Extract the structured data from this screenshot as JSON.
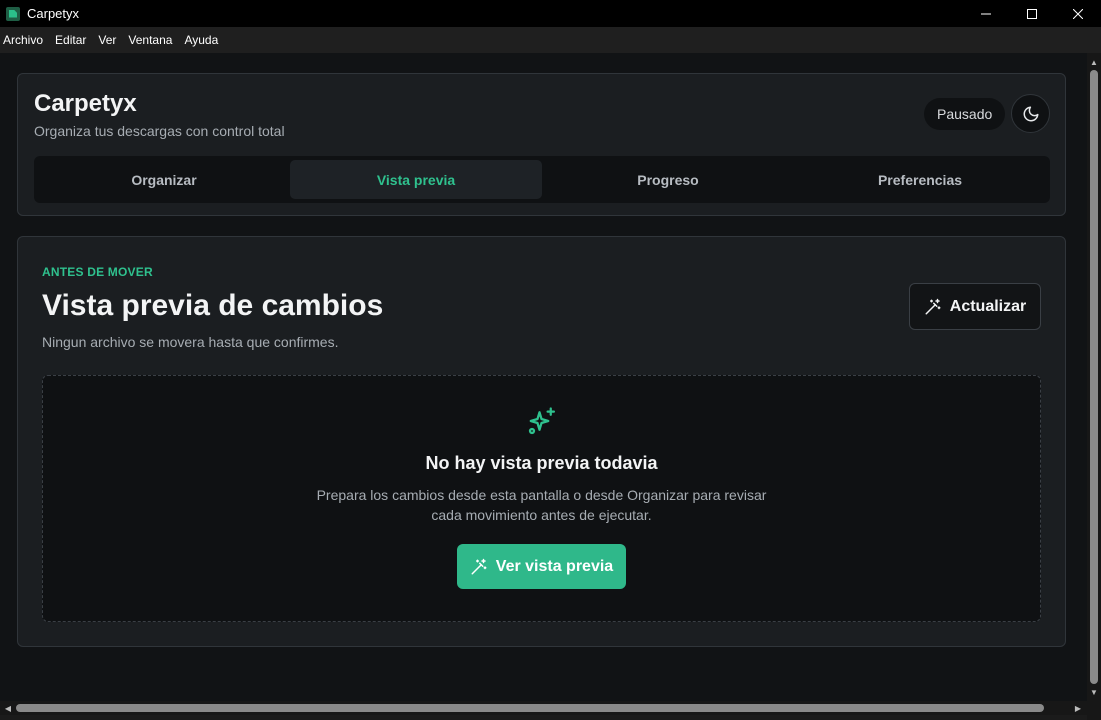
{
  "window": {
    "title": "Carpetyx",
    "controls": {
      "minimize": "─",
      "maximize": "☐",
      "close": "✕"
    }
  },
  "menu": [
    "Archivo",
    "Editar",
    "Ver",
    "Ventana",
    "Ayuda"
  ],
  "header": {
    "app_name": "Carpetyx",
    "tagline": "Organiza tus descargas con control total",
    "status": "Pausado",
    "theme_icon": "moon-icon"
  },
  "tabs": [
    {
      "label": "Organizar",
      "active": false
    },
    {
      "label": "Vista previa",
      "active": true
    },
    {
      "label": "Progreso",
      "active": false
    },
    {
      "label": "Preferencias",
      "active": false
    }
  ],
  "preview": {
    "eyebrow": "ANTES DE MOVER",
    "title": "Vista previa de cambios",
    "subtitle": "Ningun archivo se movera hasta que confirmes.",
    "refresh_label": "Actualizar",
    "empty": {
      "icon": "sparkles-icon",
      "title": "No hay vista previa todavia",
      "description_line1": "Prepara los cambios desde esta pantalla o desde Organizar para revisar",
      "description_line2": "cada movimiento antes de ejecutar.",
      "button_label": "Ver vista previa"
    }
  },
  "colors": {
    "accent": "#2fc18e",
    "button_primary": "#2fb88a",
    "background": "#111315",
    "card": "#1b1e21"
  }
}
